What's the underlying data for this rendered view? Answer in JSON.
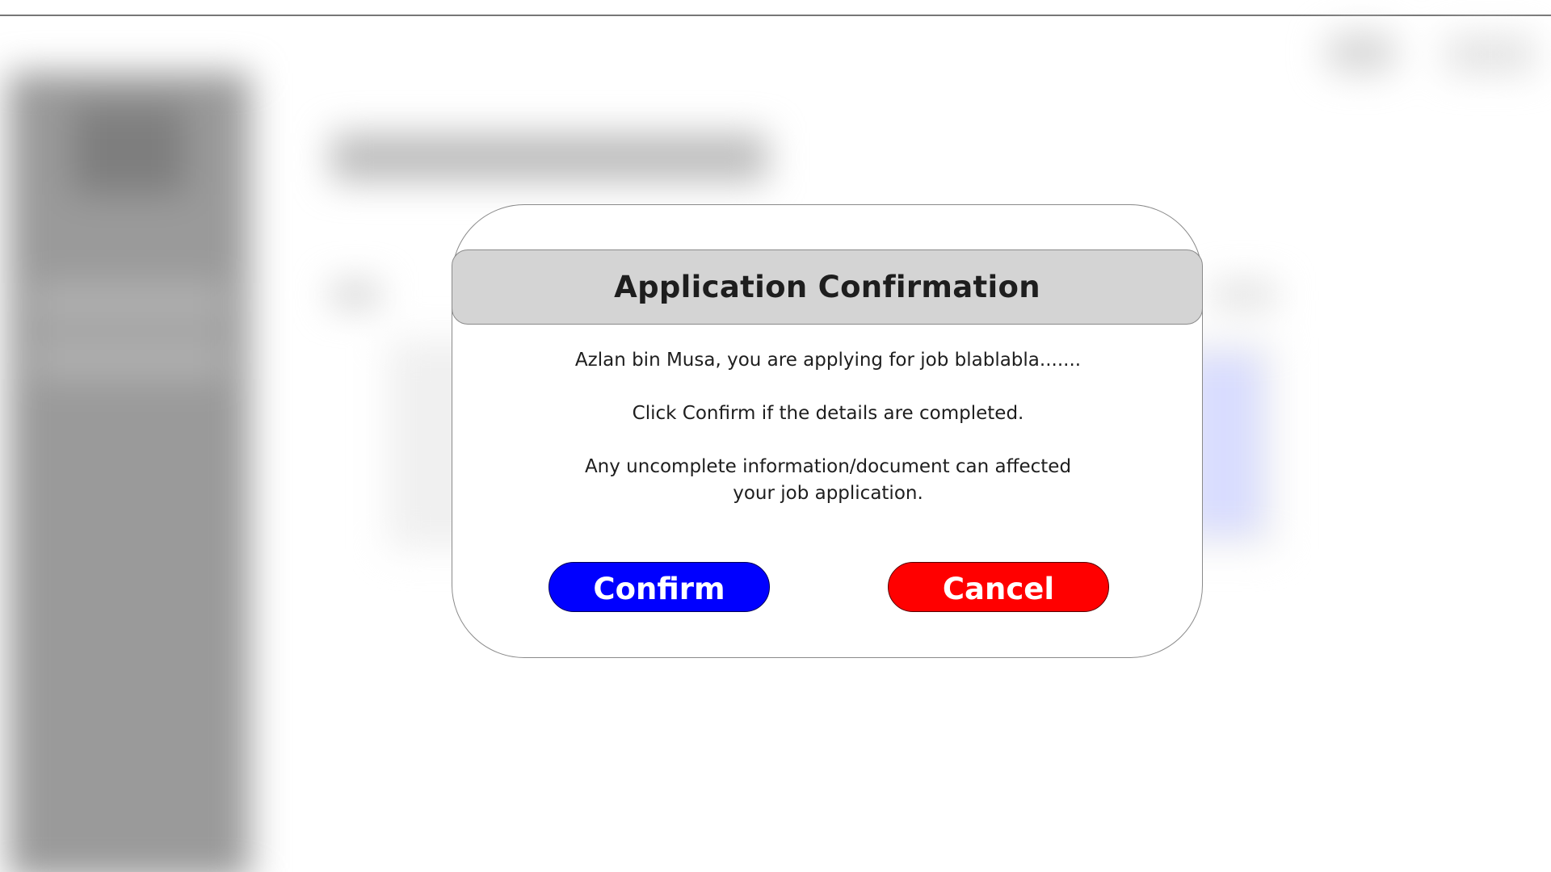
{
  "dialog": {
    "title": "Application Confirmation",
    "message_lines": [
      "Azlan bin Musa, you are applying for job blablabla.......",
      "Click Confirm if the details are completed.",
      "Any uncomplete information/document can affected",
      "your job application."
    ],
    "confirm_label": "Confirm",
    "cancel_label": "Cancel"
  },
  "colors": {
    "confirm_button": "#0000ff",
    "cancel_button": "#ff0000",
    "header_background": "#d4d4d4",
    "backdrop_sidebar": "#9a9a9a"
  }
}
